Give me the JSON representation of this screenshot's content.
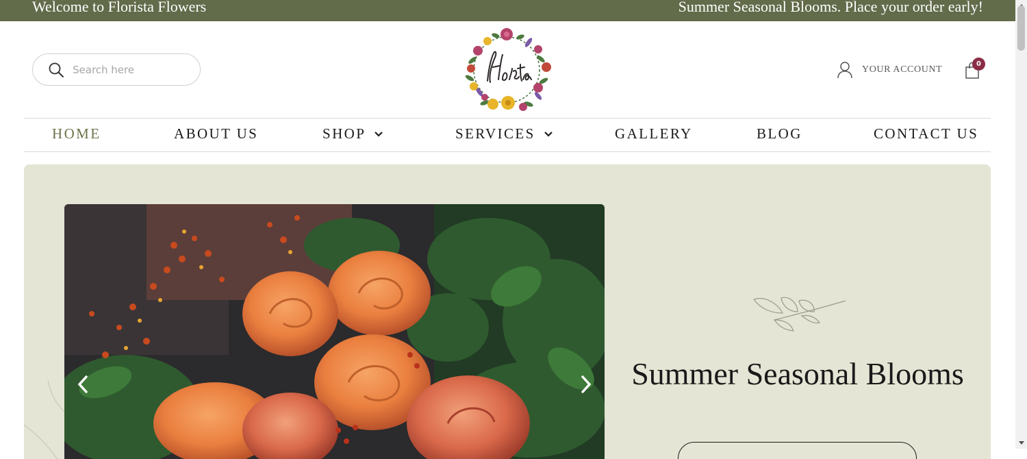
{
  "topbar": {
    "welcome": "Welcome to Florista Flowers",
    "promo": "Summer Seasonal Blooms. Place your order early!"
  },
  "search": {
    "placeholder": "Search here"
  },
  "account": {
    "label": "YOUR ACCOUNT"
  },
  "cart": {
    "count": "0"
  },
  "nav": {
    "items": [
      {
        "label": "HOME"
      },
      {
        "label": "ABOUT US"
      },
      {
        "label": "SHOP"
      },
      {
        "label": "SERVICES"
      },
      {
        "label": "GALLERY"
      },
      {
        "label": "BLOG"
      },
      {
        "label": "CONTACT US"
      }
    ]
  },
  "hero": {
    "heading": "Summer Seasonal Blooms"
  },
  "colors": {
    "topbar": "#626b4a",
    "nav_active": "#6b7349",
    "hero_bg": "#e4e5d4",
    "cart_badge": "#8a2d47"
  },
  "icons": {
    "search": "search-icon",
    "account": "user-icon",
    "cart": "shopping-bag-icon",
    "dropdown": "chevron-down-icon",
    "slider_prev": "chevron-left-icon",
    "slider_next": "chevron-right-icon"
  }
}
